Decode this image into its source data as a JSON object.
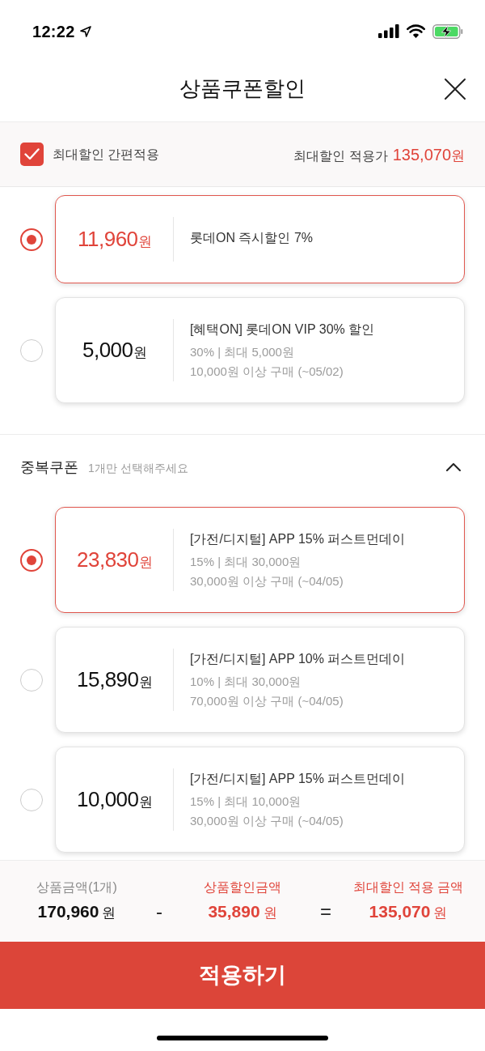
{
  "status_bar": {
    "time": "12:22"
  },
  "header": {
    "title": "상품쿠폰할인"
  },
  "max_discount_bar": {
    "label": "최대할인 간편적용",
    "checked": true,
    "price_label": "최대할인 적용가",
    "price": "135,070",
    "currency": "원"
  },
  "coupons": [
    {
      "selected": true,
      "amount": "11,960",
      "currency": "원",
      "title": "롯데ON 즉시할인 7%"
    },
    {
      "selected": false,
      "amount": "5,000",
      "currency": "원",
      "title": "[혜택ON] 롯데ON VIP 30% 할인",
      "details": [
        "30% | 최대 5,000원",
        "10,000원 이상 구매 (~05/02)"
      ]
    }
  ],
  "duplicate_coupons": {
    "title": "중복쿠폰",
    "hint": "1개만 선택해주세요",
    "expanded": true,
    "coupons": [
      {
        "selected": true,
        "amount": "23,830",
        "currency": "원",
        "title": "[가전/디지털] APP 15% 퍼스트먼데이",
        "details": [
          "15% | 최대 30,000원",
          "30,000원 이상 구매 (~04/05)"
        ]
      },
      {
        "selected": false,
        "amount": "15,890",
        "currency": "원",
        "title": "[가전/디지털] APP 10% 퍼스트먼데이",
        "details": [
          "10% | 최대 30,000원",
          "70,000원 이상 구매 (~04/05)"
        ]
      },
      {
        "selected": false,
        "amount": "10,000",
        "currency": "원",
        "title": "[가전/디지털] APP 15% 퍼스트먼데이",
        "details": [
          "15% | 최대 10,000원",
          "30,000원 이상 구매 (~04/05)"
        ]
      }
    ]
  },
  "summary": {
    "columns": [
      {
        "label": "상품금액(1개)",
        "amount": "170,960",
        "currency": "원",
        "highlighted": false
      },
      {
        "label": "상품할인금액",
        "amount": "35,890",
        "currency": "원",
        "highlighted": true
      },
      {
        "label": "최대할인 적용 금액",
        "amount": "135,070",
        "currency": "원",
        "highlighted": true
      }
    ],
    "operators": [
      "-",
      "="
    ]
  },
  "apply_button": {
    "label": "적용하기"
  }
}
